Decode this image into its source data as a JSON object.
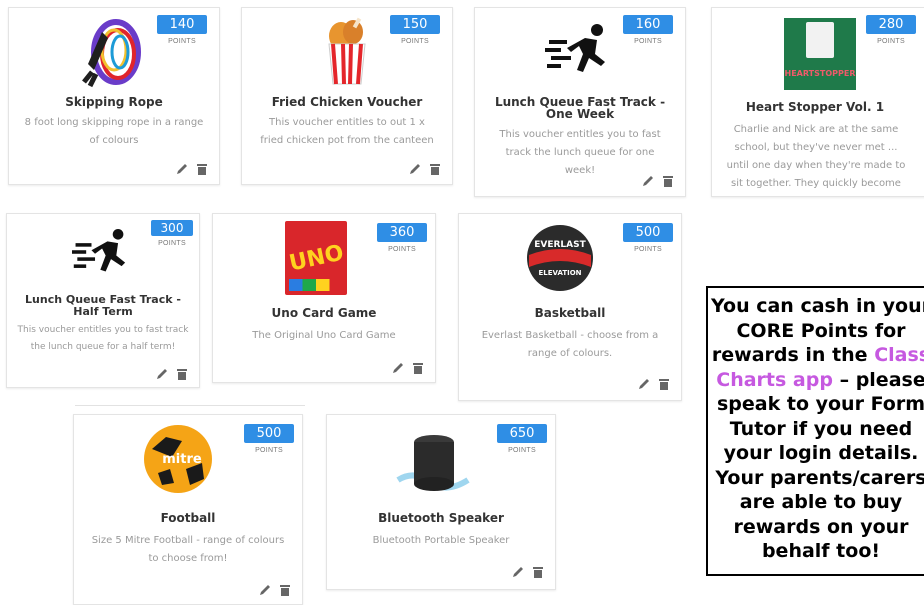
{
  "points_label": "POINTS",
  "rewards": [
    {
      "id": "skipping-rope",
      "title": "Skipping Rope",
      "points": "140",
      "description": "8 foot long skipping rope in a range of colours",
      "icon": "skipping-rope-image"
    },
    {
      "id": "fried-chicken",
      "title": "Fried Chicken Voucher",
      "points": "150",
      "description": "This voucher entitles to out 1 x fried chicken pot from the canteen",
      "icon": "fried-chicken-image"
    },
    {
      "id": "lunch-week",
      "title": "Lunch Queue Fast Track - One Week",
      "points": "160",
      "description": "This voucher entitles you to fast track the lunch queue for one week!",
      "icon": "running-person-icon"
    },
    {
      "id": "heartstopper",
      "title": "Heart Stopper Vol. 1",
      "points": "280",
      "description": "Charlie and Nick are at the same school, but they've never met ... until one day when they're made to sit together. They quickly become friends,",
      "icon": "book-cover-image",
      "cover_text": "HEARTSTOPPER"
    },
    {
      "id": "lunch-term",
      "title": "Lunch Queue Fast Track - Half Term",
      "points": "300",
      "description": "This voucher entitles you to fast track the lunch queue for a half term!",
      "icon": "running-person-icon"
    },
    {
      "id": "uno",
      "title": "Uno Card Game",
      "points": "360",
      "description": "The Original Uno Card Game",
      "icon": "uno-box-image",
      "box_text": "UNO"
    },
    {
      "id": "basketball",
      "title": "Basketball",
      "points": "500",
      "description": "Everlast Basketball - choose from a range of colours.",
      "icon": "basketball-image",
      "ball_text_top": "EVERLAST",
      "ball_text_bottom": "ELEVATION"
    },
    {
      "id": "football",
      "title": "Football",
      "points": "500",
      "description": "Size 5 Mitre Football - range of colours to choose from!",
      "icon": "football-image",
      "ball_text": "mitre"
    },
    {
      "id": "speaker",
      "title": "Bluetooth Speaker",
      "points": "650",
      "description": "Bluetooth Portable Speaker",
      "icon": "speaker-image"
    }
  ],
  "notice": {
    "part1": "You can cash in your CORE Points for rewards in the ",
    "highlight": "Class Charts app",
    "part2": " – please speak to your Form Tutor if you need your login details.  Your parents/carers are able to buy rewards on your behalf too!",
    "highlight_color": "#c659e0"
  },
  "colors": {
    "badge": "#2f8ee5",
    "title": "#333333",
    "desc": "#9a9a9a"
  }
}
